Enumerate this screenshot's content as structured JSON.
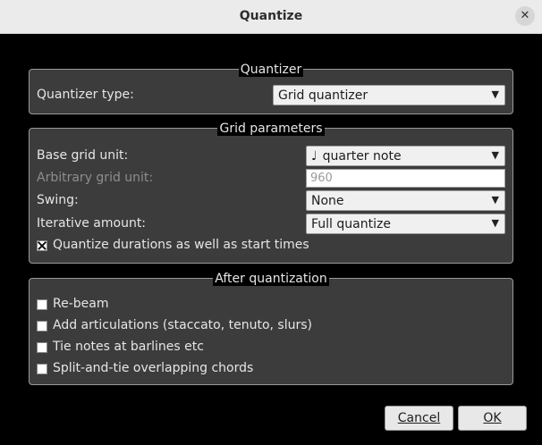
{
  "window": {
    "title": "Quantize"
  },
  "quantizer": {
    "title": "Quantizer",
    "type_label": "Quantizer type:",
    "type_value": "Grid quantizer"
  },
  "grid": {
    "title": "Grid parameters",
    "base_label": "Base grid unit:",
    "base_icon": "♩",
    "base_value": "quarter note",
    "arbitrary_label": "Arbitrary grid unit:",
    "arbitrary_value": "960",
    "swing_label": "Swing:",
    "swing_value": "None",
    "iterative_label": "Iterative amount:",
    "iterative_value": "Full quantize",
    "durations_label": "Quantize durations as well as start times",
    "durations_checked": true
  },
  "after": {
    "title": "After quantization",
    "options": [
      {
        "label": "Re-beam",
        "checked": false
      },
      {
        "label": "Add articulations (staccato, tenuto, slurs)",
        "checked": false
      },
      {
        "label": "Tie notes at barlines etc",
        "checked": false
      },
      {
        "label": "Split-and-tie overlapping chords",
        "checked": false
      }
    ]
  },
  "buttons": {
    "cancel_label": "Cancel",
    "ok_label": "OK"
  }
}
